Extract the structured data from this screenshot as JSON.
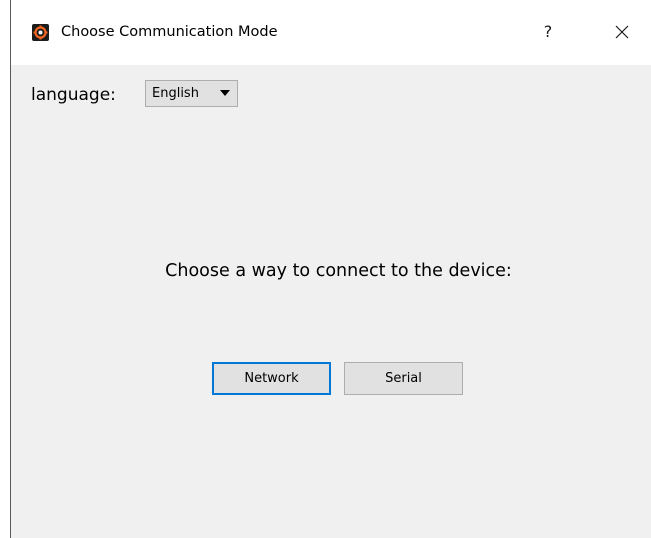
{
  "window": {
    "title": "Choose Communication Mode",
    "help_label": "?",
    "icons": {
      "app": "app-gear-icon",
      "close": "close-icon",
      "dropdown": "chevron-down-icon"
    }
  },
  "language": {
    "label": "language:",
    "selected": "English"
  },
  "main": {
    "prompt": "Choose a way to connect to the device:",
    "network_label": "Network",
    "serial_label": "Serial"
  },
  "colors": {
    "background": "#f0f0f0",
    "button_face": "#e1e1e1",
    "focus_accent": "#0078d7",
    "app_icon_accent": "#f26522"
  }
}
